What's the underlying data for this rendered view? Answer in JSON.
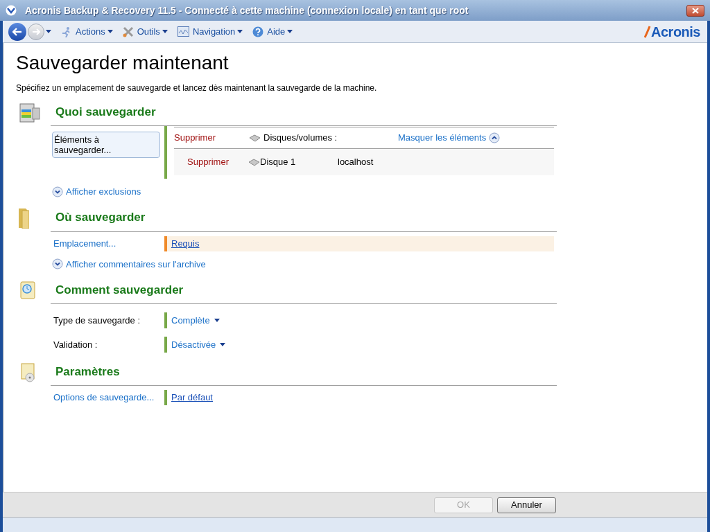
{
  "window": {
    "title": "Acronis Backup & Recovery 11.5 - Connecté à cette machine (connexion locale) en tant que root"
  },
  "toolbar": {
    "menus": [
      {
        "kind": "actions",
        "label": "Actions"
      },
      {
        "kind": "tools",
        "label": "Outils"
      },
      {
        "kind": "navigation",
        "label": "Navigation"
      },
      {
        "kind": "help",
        "label": "Aide"
      }
    ],
    "logo": "Acronis"
  },
  "page": {
    "title": "Sauvegarder maintenant",
    "description": "Spécifiez un emplacement de sauvegarde et lancez dès maintenant la sauvegarde de la machine."
  },
  "sections": [
    {
      "kind": "items",
      "heading": "Quoi sauvegarder",
      "rows": [
        {
          "kind": "selection",
          "button": "Éléments à sauvegarder...",
          "header": {
            "remove": "Supprimer",
            "label": "Disques/volumes :",
            "toggle": "Masquer les éléments"
          },
          "items": [
            {
              "remove": "Supprimer",
              "name": "Disque 1",
              "host": "localhost"
            }
          ]
        }
      ],
      "expander": "Afficher exclusions"
    },
    {
      "kind": "folder",
      "heading": "Où sauvegarder",
      "rows": [
        {
          "kind": "link",
          "label": "Emplacement...",
          "value": "Requis",
          "required": true
        }
      ],
      "expander": "Afficher commentaires sur l'archive"
    },
    {
      "kind": "schedule",
      "heading": "Comment sauvegarder",
      "rows": [
        {
          "kind": "dropdown",
          "label": "Type de sauvegarde :",
          "value": "Complète"
        },
        {
          "kind": "dropdown",
          "label": "Validation :",
          "value": "Désactivée"
        }
      ]
    },
    {
      "kind": "settings",
      "heading": "Paramètres",
      "rows": [
        {
          "kind": "link",
          "label": "Options de sauvegarde...",
          "value": "Par défaut",
          "required": false
        }
      ]
    }
  ],
  "buttons": [
    {
      "label": "OK",
      "disabled": true
    },
    {
      "label": "Annuler",
      "disabled": false
    }
  ]
}
